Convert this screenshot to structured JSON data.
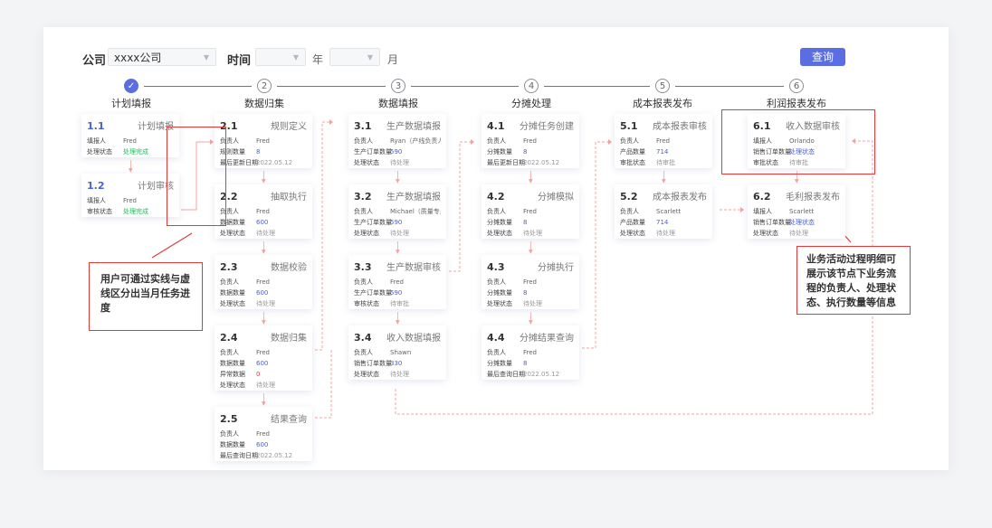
{
  "filters": {
    "company_label": "公司",
    "company_value": "xxxx公司",
    "time_label": "时间",
    "year_value": "",
    "year_unit": "年",
    "month_value": "",
    "month_unit": "月",
    "query_label": "查询"
  },
  "steps": [
    {
      "num": "✓",
      "title": "计划填报",
      "done": true
    },
    {
      "num": "2",
      "title": "数据归集",
      "done": false
    },
    {
      "num": "3",
      "title": "数据填报",
      "done": false
    },
    {
      "num": "4",
      "title": "分摊处理",
      "done": false
    },
    {
      "num": "5",
      "title": "成本报表发布",
      "done": false
    },
    {
      "num": "6",
      "title": "利润报表发布",
      "done": false
    }
  ],
  "columns": [
    {
      "cards": [
        {
          "num": "1.1",
          "name": "计划填报",
          "blue": true,
          "rows": [
            {
              "k": "填报人",
              "v": "Fred",
              "c": ""
            },
            {
              "k": "处理状态",
              "v": "处理完成",
              "c": "green"
            }
          ]
        },
        {
          "num": "1.2",
          "name": "计划审核",
          "blue": true,
          "rows": [
            {
              "k": "填报人",
              "v": "Fred",
              "c": ""
            },
            {
              "k": "审核状态",
              "v": "处理完成",
              "c": "green"
            }
          ]
        }
      ]
    },
    {
      "cards": [
        {
          "num": "2.1",
          "name": "规则定义",
          "blue": false,
          "rows": [
            {
              "k": "负责人",
              "v": "Fred",
              "c": ""
            },
            {
              "k": "规则数量",
              "v": "8",
              "c": "blue"
            },
            {
              "k": "最后更新日期",
              "v": "2022.05.12",
              "c": "gray"
            }
          ]
        },
        {
          "num": "2.2",
          "name": "抽取执行",
          "blue": false,
          "rows": [
            {
              "k": "负责人",
              "v": "Fred",
              "c": ""
            },
            {
              "k": "数据数量",
              "v": "600",
              "c": "blue"
            },
            {
              "k": "处理状态",
              "v": "待处理",
              "c": "gray"
            }
          ]
        },
        {
          "num": "2.3",
          "name": "数据校验",
          "blue": false,
          "rows": [
            {
              "k": "负责人",
              "v": "Fred",
              "c": ""
            },
            {
              "k": "数据数量",
              "v": "600",
              "c": "blue"
            },
            {
              "k": "处理状态",
              "v": "待处理",
              "c": "gray"
            }
          ]
        },
        {
          "num": "2.4",
          "name": "数据归集",
          "blue": false,
          "rows": [
            {
              "k": "负责人",
              "v": "Fred",
              "c": ""
            },
            {
              "k": "数据数量",
              "v": "600",
              "c": "blue"
            },
            {
              "k": "异常数据",
              "v": "0",
              "c": "red"
            },
            {
              "k": "处理状态",
              "v": "待处理",
              "c": "gray"
            }
          ]
        },
        {
          "num": "2.5",
          "name": "结果查询",
          "blue": false,
          "rows": [
            {
              "k": "负责人",
              "v": "Fred",
              "c": ""
            },
            {
              "k": "数据数量",
              "v": "600",
              "c": "blue"
            },
            {
              "k": "最后查询日期",
              "v": "2022.05.12",
              "c": "gray"
            }
          ]
        }
      ]
    },
    {
      "cards": [
        {
          "num": "3.1",
          "name": "生产数据填报",
          "blue": false,
          "rows": [
            {
              "k": "负责人",
              "v": "Ryan（产线负责人）",
              "c": ""
            },
            {
              "k": "生产订单数量",
              "v": "590",
              "c": "blue"
            },
            {
              "k": "处理状态",
              "v": "待处理",
              "c": "gray"
            }
          ]
        },
        {
          "num": "3.2",
          "name": "生产数据填报",
          "blue": false,
          "rows": [
            {
              "k": "负责人",
              "v": "Michael（质量专员）",
              "c": ""
            },
            {
              "k": "生产订单数量",
              "v": "590",
              "c": "blue"
            },
            {
              "k": "处理状态",
              "v": "待处理",
              "c": "gray"
            }
          ]
        },
        {
          "num": "3.3",
          "name": "生产数据审核",
          "blue": false,
          "rows": [
            {
              "k": "负责人",
              "v": "Fred",
              "c": ""
            },
            {
              "k": "生产订单数量",
              "v": "590",
              "c": "blue"
            },
            {
              "k": "审核状态",
              "v": "待审批",
              "c": "gray"
            }
          ]
        },
        {
          "num": "3.4",
          "name": "收入数据填报",
          "blue": false,
          "rows": [
            {
              "k": "负责人",
              "v": "Shawn",
              "c": ""
            },
            {
              "k": "销售订单数量",
              "v": "330",
              "c": "blue"
            },
            {
              "k": "处理状态",
              "v": "待处理",
              "c": "gray"
            }
          ]
        }
      ]
    },
    {
      "cards": [
        {
          "num": "4.1",
          "name": "分摊任务创建",
          "blue": false,
          "rows": [
            {
              "k": "负责人",
              "v": "Fred",
              "c": ""
            },
            {
              "k": "分摊数量",
              "v": "8",
              "c": "blue"
            },
            {
              "k": "最后更新日期",
              "v": "2022.05.12",
              "c": "gray"
            }
          ]
        },
        {
          "num": "4.2",
          "name": "分摊模拟",
          "blue": false,
          "rows": [
            {
              "k": "负责人",
              "v": "Fred",
              "c": ""
            },
            {
              "k": "分摊数量",
              "v": "8",
              "c": "blue"
            },
            {
              "k": "处理状态",
              "v": "待处理",
              "c": "gray"
            }
          ]
        },
        {
          "num": "4.3",
          "name": "分摊执行",
          "blue": false,
          "rows": [
            {
              "k": "负责人",
              "v": "Fred",
              "c": ""
            },
            {
              "k": "分摊数量",
              "v": "8",
              "c": "blue"
            },
            {
              "k": "处理状态",
              "v": "待处理",
              "c": "gray"
            }
          ]
        },
        {
          "num": "4.4",
          "name": "分摊结果查询",
          "blue": false,
          "rows": [
            {
              "k": "负责人",
              "v": "Fred",
              "c": ""
            },
            {
              "k": "分摊数量",
              "v": "8",
              "c": "blue"
            },
            {
              "k": "最后查询日期",
              "v": "2022.05.12",
              "c": "gray"
            }
          ]
        }
      ]
    },
    {
      "cards": [
        {
          "num": "5.1",
          "name": "成本报表审核",
          "blue": false,
          "rows": [
            {
              "k": "负责人",
              "v": "Fred",
              "c": ""
            },
            {
              "k": "产品数量",
              "v": "714",
              "c": "blue"
            },
            {
              "k": "审批状态",
              "v": "待审批",
              "c": "gray"
            }
          ]
        },
        {
          "num": "5.2",
          "name": "成本报表发布",
          "blue": false,
          "rows": [
            {
              "k": "负责人",
              "v": "Scarlett",
              "c": ""
            },
            {
              "k": "产品数量",
              "v": "714",
              "c": "blue"
            },
            {
              "k": "处理状态",
              "v": "待处理",
              "c": "gray"
            }
          ]
        }
      ]
    },
    {
      "cards": [
        {
          "num": "6.1",
          "name": "收入数据审核",
          "blue": false,
          "rows": [
            {
              "k": "填报人",
              "v": "Orlando",
              "c": ""
            },
            {
              "k": "销售订单数量",
              "v": "处理状态",
              "c": "blue"
            },
            {
              "k": "审批状态",
              "v": "待审批",
              "c": "gray"
            }
          ]
        },
        {
          "num": "6.2",
          "name": "毛利报表发布",
          "blue": false,
          "rows": [
            {
              "k": "填报人",
              "v": "Scarlett",
              "c": ""
            },
            {
              "k": "销售订单数量",
              "v": "处理状态",
              "c": "blue"
            },
            {
              "k": "处理状态",
              "v": "待处理",
              "c": "gray"
            }
          ]
        }
      ]
    }
  ],
  "annotations": {
    "left": "用户可通过实线与虚线区分出当月任务进度",
    "right": "业务活动过程明细可展示该节点下业务流程的负责人、处理状态、执行数量等信息"
  },
  "colors": {
    "accent": "#5b6ee1",
    "annotation": "#e23b3b",
    "dashed": "#f1a3a3"
  }
}
